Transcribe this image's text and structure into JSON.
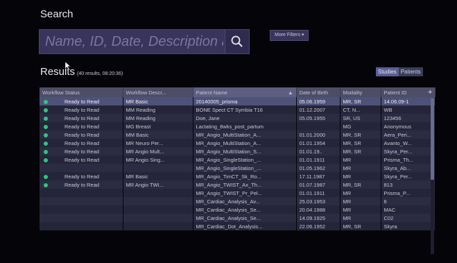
{
  "search": {
    "title": "Search",
    "placeholder": "Name, ID, Date, Description and",
    "more_filters_label": "More Filters ▾"
  },
  "results": {
    "title": "Results",
    "meta": "(40 results, 08:20:36)",
    "toggle": {
      "studies": "Studies",
      "patients": "Patients"
    }
  },
  "table": {
    "columns": [
      "Workflow Status",
      "Workflow Descr...",
      "Patient Name",
      "Date of Birth",
      "Modality",
      "Patient ID"
    ],
    "sort_indicator": "▲",
    "add_column_label": "+",
    "rows": [
      {
        "status": "Ready to Read",
        "desc": "MR Basic",
        "name": "20140005_prisma",
        "dob": "05.06.1959",
        "mod": "MR, SR",
        "pid": "14.06.09-1"
      },
      {
        "status": "Ready to Read",
        "desc": "MM Reading",
        "name": "BONE Spect CT Symbia T16",
        "dob": "01.12.2007",
        "mod": "CT, N...",
        "pid": "WB"
      },
      {
        "status": "Ready to Read",
        "desc": "MM Reading",
        "name": "Doe, Jane",
        "dob": "05.05.1955",
        "mod": "SR, US",
        "pid": "123456"
      },
      {
        "status": "Ready to Read",
        "desc": "MG Breast",
        "name": "Lactating_8wks_post_partum",
        "dob": "",
        "mod": "MG",
        "pid": "Anonymous"
      },
      {
        "status": "Ready to Read",
        "desc": "MM Basic",
        "name": "MR_Angio_MultiStation_A...",
        "dob": "01.01.2000",
        "mod": "MR, SR",
        "pid": "Aera_Peri..."
      },
      {
        "status": "Ready to Read",
        "desc": "MR Neuro Per...",
        "name": "MR_Angio_MultiStation_A...",
        "dob": "01.01.1954",
        "mod": "MR, SR",
        "pid": "Avanto_W..."
      },
      {
        "status": "Ready to Read",
        "desc": "MR Angio Mult...",
        "name": "MR_Angio_MultiStation_S...",
        "dob": "01.01.19..",
        "mod": "MR, SR",
        "pid": "Skyra_Per..."
      },
      {
        "status": "Ready to Read",
        "desc": "MR Angio Sing...",
        "name": "MR_Angio_SingleStation_...",
        "dob": "01.01.1911",
        "mod": "MR",
        "pid": "Prisma_Th..."
      },
      {
        "status": "",
        "desc": "",
        "name": "MR_Angio_SingleStation_...",
        "dob": "01.05.1962",
        "mod": "MR",
        "pid": "Skyra_Ab..."
      },
      {
        "status": "Ready to Read",
        "desc": "MR Basic",
        "name": "MR_Angio_TimCT_Sk_Ro...",
        "dob": "17.11.1987",
        "mod": "MR",
        "pid": "Skyra_Per..."
      },
      {
        "status": "Ready to Read",
        "desc": "MR Angio TWI...",
        "name": "MR_Angio_TWIST_Ax_Th...",
        "dob": "01.07.1987",
        "mod": "MR, SR",
        "pid": "813"
      },
      {
        "status": "",
        "desc": "",
        "name": "MR_Angio_TWIST_Pr_Pel...",
        "dob": "01.01.1911",
        "mod": "MR",
        "pid": "Prisma_P..."
      },
      {
        "status": "",
        "desc": "",
        "name": "MR_Cardiac_Analysis_Av...",
        "dob": "25.03.1953",
        "mod": "MR",
        "pid": "6"
      },
      {
        "status": "",
        "desc": "",
        "name": "MR_Cardiac_Analysis_Se...",
        "dob": "20.04.1988",
        "mod": "MR",
        "pid": "MAC"
      },
      {
        "status": "",
        "desc": "",
        "name": "MR_Cardiac_Analysis_Se...",
        "dob": "14.09.1925",
        "mod": "MR",
        "pid": "C02"
      },
      {
        "status": "",
        "desc": "",
        "name": "MR_Cardiac_Dot_Analysis...",
        "dob": "22.06.1952",
        "mod": "MR, SR",
        "pid": "Skyra"
      }
    ]
  },
  "colors": {
    "background": "#050509",
    "search_field": "#39345c",
    "status_dot": "#2fc87a",
    "selected_row": "#4e5278"
  },
  "icons": {
    "search_button": "search-icon",
    "pointer": "mouse-pointer-icon"
  }
}
